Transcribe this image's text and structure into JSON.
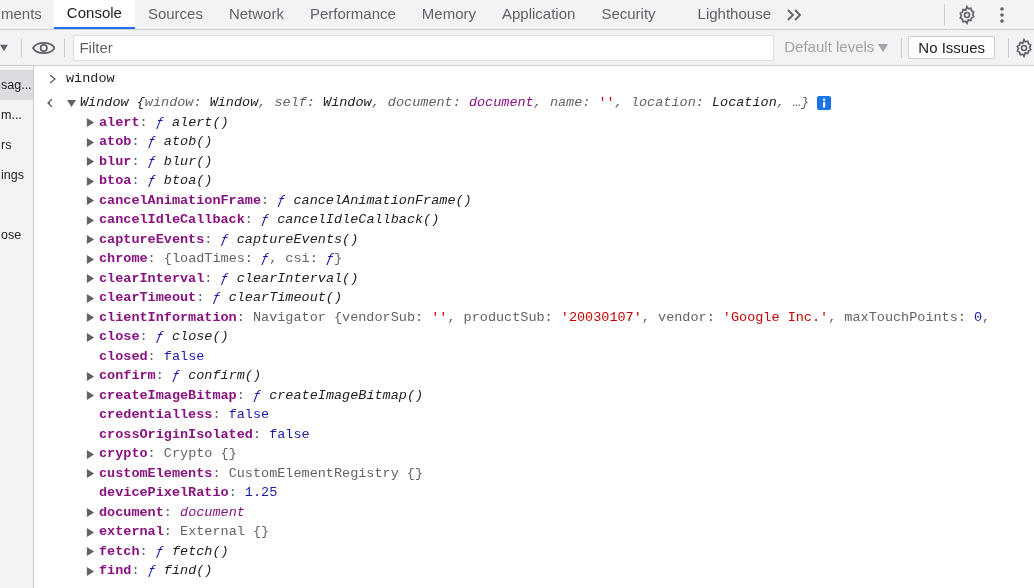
{
  "tabs": [
    {
      "label": "ments",
      "selected": false
    },
    {
      "label": "Console",
      "selected": true
    },
    {
      "label": "Sources",
      "selected": false
    },
    {
      "label": "Network",
      "selected": false
    },
    {
      "label": "Performance",
      "selected": false
    },
    {
      "label": "Memory",
      "selected": false
    },
    {
      "label": "Application",
      "selected": false
    },
    {
      "label": "Security",
      "selected": false
    },
    {
      "label": "Lighthouse",
      "selected": false
    }
  ],
  "toolbar": {
    "filter": {
      "placeholder": "Filter"
    },
    "levels": "Default levels",
    "issues_button": "No Issues"
  },
  "sidebar": {
    "items": [
      {
        "label": "sag...",
        "selected": true
      },
      {
        "label": "m...",
        "selected": false
      },
      {
        "label": "rs",
        "selected": false
      },
      {
        "label": "ings",
        "selected": false
      },
      {
        "label": "ose",
        "selected": false
      }
    ]
  },
  "console": {
    "input": "window",
    "result": {
      "expanded": true,
      "tokens": [
        {
          "kind": "value",
          "text": "Window "
        },
        {
          "kind": "value",
          "text": "{"
        },
        {
          "kind": "key",
          "text": "window: "
        },
        {
          "kind": "value",
          "text": "Window"
        },
        {
          "kind": "key",
          "text": ", self: "
        },
        {
          "kind": "value",
          "text": "Window"
        },
        {
          "kind": "key",
          "text": ", document: "
        },
        {
          "kind": "node",
          "text": "document"
        },
        {
          "kind": "key",
          "text": ", name: "
        },
        {
          "kind": "str",
          "text": "''"
        },
        {
          "kind": "key",
          "text": ", location: "
        },
        {
          "kind": "value",
          "text": "Location"
        },
        {
          "kind": "key",
          "text": ", …}"
        }
      ],
      "properties": [
        {
          "name": "alert",
          "separator": ":",
          "expandable": true,
          "value": [
            {
              "kind": "fmark",
              "text": "ƒ"
            },
            {
              "kind": "fname",
              "text": "alert()"
            }
          ]
        },
        {
          "name": "atob",
          "separator": ":",
          "expandable": true,
          "value": [
            {
              "kind": "fmark",
              "text": "ƒ"
            },
            {
              "kind": "fname",
              "text": "atob()"
            }
          ]
        },
        {
          "name": "blur",
          "separator": ":",
          "expandable": true,
          "value": [
            {
              "kind": "fmark",
              "text": "ƒ"
            },
            {
              "kind": "fname",
              "text": "blur()"
            }
          ]
        },
        {
          "name": "btoa",
          "separator": ":",
          "expandable": true,
          "value": [
            {
              "kind": "fmark",
              "text": "ƒ"
            },
            {
              "kind": "fname",
              "text": "btoa()"
            }
          ]
        },
        {
          "name": "cancelAnimationFrame",
          "separator": ":",
          "expandable": true,
          "value": [
            {
              "kind": "fmark",
              "text": "ƒ"
            },
            {
              "kind": "fname",
              "text": "cancelAnimationFrame()"
            }
          ]
        },
        {
          "name": "cancelIdleCallback",
          "separator": ":",
          "expandable": true,
          "value": [
            {
              "kind": "fmark",
              "text": "ƒ"
            },
            {
              "kind": "fname",
              "text": "cancelIdleCallback()"
            }
          ]
        },
        {
          "name": "captureEvents",
          "separator": ":",
          "expandable": true,
          "value": [
            {
              "kind": "fmark",
              "text": "ƒ"
            },
            {
              "kind": "fname",
              "text": "captureEvents()"
            }
          ]
        },
        {
          "name": "chrome",
          "separator": ":",
          "expandable": true,
          "value": [
            {
              "kind": "obj",
              "text": "{loadTimes: "
            },
            {
              "kind": "fmark",
              "text": "ƒ"
            },
            {
              "kind": "obj",
              "text": ", csi: "
            },
            {
              "kind": "fmark",
              "text": "ƒ"
            },
            {
              "kind": "obj",
              "text": "}"
            }
          ]
        },
        {
          "name": "clearInterval",
          "separator": ":",
          "expandable": true,
          "value": [
            {
              "kind": "fmark",
              "text": "ƒ"
            },
            {
              "kind": "fname",
              "text": "clearInterval()"
            }
          ]
        },
        {
          "name": "clearTimeout",
          "separator": ":",
          "expandable": true,
          "value": [
            {
              "kind": "fmark",
              "text": "ƒ"
            },
            {
              "kind": "fname",
              "text": "clearTimeout()"
            }
          ]
        },
        {
          "name": "clientInformation",
          "separator": ":",
          "expandable": true,
          "value": [
            {
              "kind": "obj",
              "text": "Navigator {vendorSub: "
            },
            {
              "kind": "str",
              "text": "''"
            },
            {
              "kind": "obj",
              "text": ", productSub: "
            },
            {
              "kind": "str",
              "text": "'20030107'"
            },
            {
              "kind": "obj",
              "text": ", vendor: "
            },
            {
              "kind": "str",
              "text": "'Google Inc.'"
            },
            {
              "kind": "obj",
              "text": ", maxTouchPoints: "
            },
            {
              "kind": "num",
              "text": "0"
            },
            {
              "kind": "obj",
              "text": ","
            }
          ]
        },
        {
          "name": "close",
          "separator": ":",
          "expandable": true,
          "value": [
            {
              "kind": "fmark",
              "text": "ƒ"
            },
            {
              "kind": "fname",
              "text": "close()"
            }
          ]
        },
        {
          "name": "closed",
          "separator": ":",
          "expandable": false,
          "value": [
            {
              "kind": "num",
              "text": "false"
            }
          ]
        },
        {
          "name": "confirm",
          "separator": ":",
          "expandable": true,
          "value": [
            {
              "kind": "fmark",
              "text": "ƒ"
            },
            {
              "kind": "fname",
              "text": "confirm()"
            }
          ]
        },
        {
          "name": "createImageBitmap",
          "separator": ":",
          "expandable": true,
          "value": [
            {
              "kind": "fmark",
              "text": "ƒ"
            },
            {
              "kind": "fname",
              "text": "createImageBitmap()"
            }
          ]
        },
        {
          "name": "credentialless",
          "separator": ":",
          "expandable": false,
          "value": [
            {
              "kind": "num",
              "text": "false"
            }
          ]
        },
        {
          "name": "crossOriginIsolated",
          "separator": ":",
          "expandable": false,
          "value": [
            {
              "kind": "num",
              "text": "false"
            }
          ]
        },
        {
          "name": "crypto",
          "separator": ":",
          "expandable": true,
          "value": [
            {
              "kind": "obj",
              "text": "Crypto {}"
            }
          ]
        },
        {
          "name": "customElements",
          "separator": ":",
          "expandable": true,
          "value": [
            {
              "kind": "obj",
              "text": "CustomElementRegistry {}"
            }
          ]
        },
        {
          "name": "devicePixelRatio",
          "separator": ":",
          "expandable": false,
          "value": [
            {
              "kind": "num",
              "text": "1.25"
            }
          ]
        },
        {
          "name": "document",
          "separator": ":",
          "expandable": true,
          "value": [
            {
              "kind": "node",
              "text": "document"
            }
          ]
        },
        {
          "name": "external",
          "separator": ":",
          "expandable": true,
          "value": [
            {
              "kind": "obj",
              "text": "External {}"
            }
          ]
        },
        {
          "name": "fetch",
          "separator": ":",
          "expandable": true,
          "value": [
            {
              "kind": "fmark",
              "text": "ƒ"
            },
            {
              "kind": "fname",
              "text": "fetch()"
            }
          ]
        },
        {
          "name": "find",
          "separator": ":",
          "expandable": true,
          "value": [
            {
              "kind": "fmark",
              "text": "ƒ"
            },
            {
              "kind": "fname",
              "text": "find()"
            }
          ]
        }
      ]
    }
  }
}
